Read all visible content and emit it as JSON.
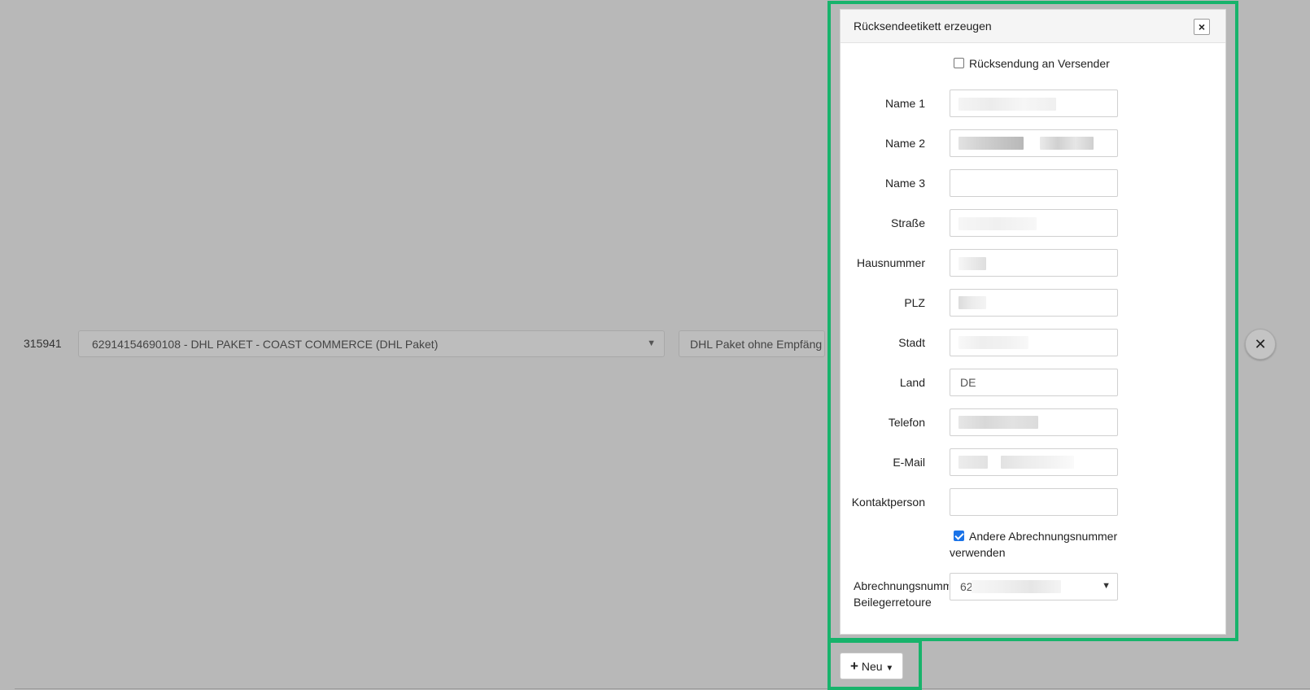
{
  "row": {
    "id": "315941",
    "account_select": "62914154690108 - DHL PAKET - COAST COMMERCE (DHL Paket)",
    "product_select": "DHL Paket ohne Empfäng",
    "remove_label": "✕"
  },
  "modal": {
    "title": "Rücksendeetikett erzeugen",
    "close_label": "×",
    "return_to_sender_label": "Rücksendung an Versender",
    "return_to_sender_checked": false,
    "fields": {
      "name1": {
        "label": "Name 1",
        "value": ""
      },
      "name2": {
        "label": "Name 2",
        "value": ""
      },
      "name3": {
        "label": "Name 3",
        "value": ""
      },
      "strasse": {
        "label": "Straße",
        "value": ""
      },
      "hausnummer": {
        "label": "Hausnummer",
        "value": ""
      },
      "plz": {
        "label": "PLZ",
        "value": ""
      },
      "stadt": {
        "label": "Stadt",
        "value": ""
      },
      "land": {
        "label": "Land",
        "value": "DE"
      },
      "telefon": {
        "label": "Telefon",
        "value": ""
      },
      "email": {
        "label": "E-Mail",
        "value": ""
      },
      "kontaktperson": {
        "label": "Kontaktperson",
        "value": ""
      }
    },
    "other_billing_label_line1": "Andere Abrechnungsnummer",
    "other_billing_label_line2": "verwenden",
    "other_billing_checked": true,
    "billing_number": {
      "label_line1": "Abrechnungsnumm",
      "label_line2": "Beilegerretoure",
      "value": "62"
    }
  },
  "new_button": {
    "label": "Neu"
  },
  "colors": {
    "highlight": "#17b36b",
    "overlay": "#b8b8b8",
    "checkbox_on": "#1a73e8"
  }
}
